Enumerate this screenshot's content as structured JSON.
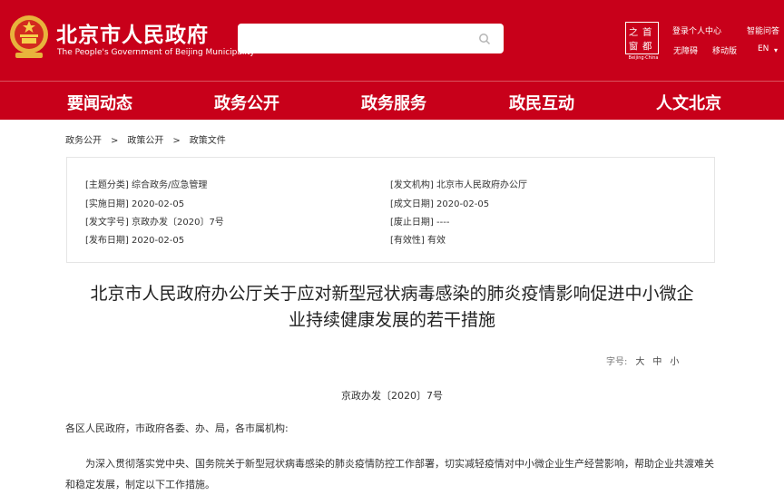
{
  "header": {
    "site_title": "北京市人民政府",
    "site_subtitle": "The People's Government of Beijing Municipality",
    "search_placeholder": "",
    "logo_chars": [
      "首",
      "之",
      "都",
      "窗"
    ],
    "logo_subtitle": "Beijing·China",
    "links": {
      "login": "登录个人中心",
      "smart_qa": "智能问答",
      "accessibility": "无障碍",
      "mobile": "移动版",
      "lang": "EN"
    },
    "colors": {
      "brand_red": "#c8001a"
    }
  },
  "nav": {
    "items": [
      "要闻动态",
      "政务公开",
      "政务服务",
      "政民互动",
      "人文北京"
    ]
  },
  "breadcrumb": [
    "政务公开",
    "政策公开",
    "政策文件"
  ],
  "info": {
    "topic_label": "[主题分类]",
    "topic_value": "综合政务/应急管理",
    "issuer_label": "[发文机构]",
    "issuer_value": "北京市人民政府办公厅",
    "effective_label": "[实施日期]",
    "effective_value": "2020-02-05",
    "written_label": "[成文日期]",
    "written_value": "2020-02-05",
    "docno_label": "[发文字号]",
    "docno_value": "京政办发〔2020〕7号",
    "repeal_label": "[废止日期]",
    "repeal_value": "----",
    "publish_label": "[发布日期]",
    "publish_value": "2020-02-05",
    "validity_label": "[有效性]",
    "validity_value": "有效"
  },
  "document": {
    "title_line1": "北京市人民政府办公厅关于应对新型冠状病毒感染的肺炎疫情影响促进中小微企",
    "title_line2": "业持续健康发展的若干措施",
    "font_size_label": "字号:",
    "font_sizes": [
      "大",
      "中",
      "小"
    ],
    "doc_number": "京政办发〔2020〕7号",
    "addressee": "各区人民政府，市政府各委、办、局，各市属机构:",
    "paragraph": "为深入贯彻落实党中央、国务院关于新型冠状病毒感染的肺炎疫情防控工作部署，切实减轻疫情对中小微企业生产经营影响，帮助企业共渡难关和稳定发展，制定以下工作措施。"
  }
}
